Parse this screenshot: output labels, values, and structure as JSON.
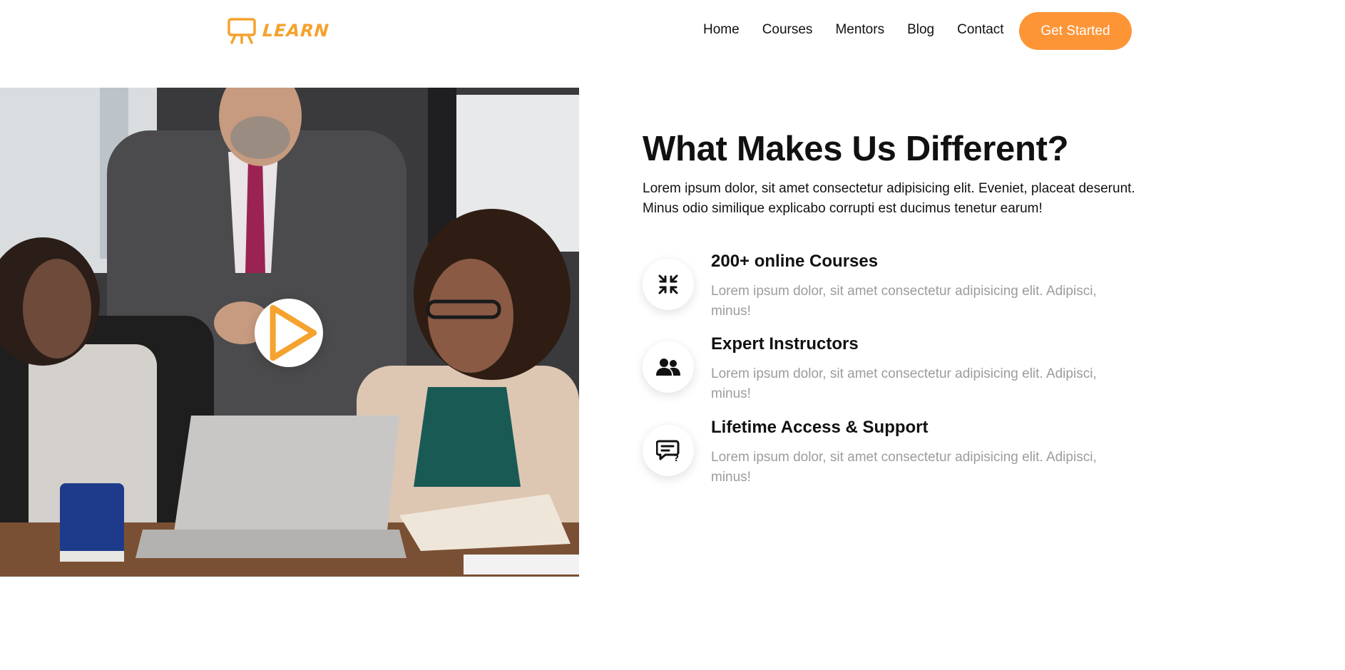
{
  "brand": {
    "name": "LEARN",
    "color": "#f5a22f"
  },
  "nav": {
    "links": [
      "Home",
      "Courses",
      "Mentors",
      "Blog",
      "Contact"
    ],
    "cta": "Get Started",
    "cta_color": "#fd9537"
  },
  "hero": {
    "image_alt": "Team meeting around a laptop",
    "play_icon": "play-icon"
  },
  "section": {
    "heading": "What Makes Us Different?",
    "lead": "Lorem ipsum dolor, sit amet consectetur adipisicing elit. Eveniet, placeat deserunt. Minus odio similique explicabo corrupti est ducimus tenetur earum!",
    "features": [
      {
        "icon": "compress-icon",
        "title": "200+ online Courses",
        "desc": "Lorem ipsum dolor, sit amet consectetur adipisicing elit. Adipisci, minus!"
      },
      {
        "icon": "users-icon",
        "title": "Expert Instructors",
        "desc": "Lorem ipsum dolor, sit amet consectetur adipisicing elit. Adipisci, minus!"
      },
      {
        "icon": "chat-question-icon",
        "title": "Lifetime Access & Support",
        "desc": "Lorem ipsum dolor, sit amet consectetur adipisicing elit. Adipisci, minus!"
      }
    ]
  }
}
